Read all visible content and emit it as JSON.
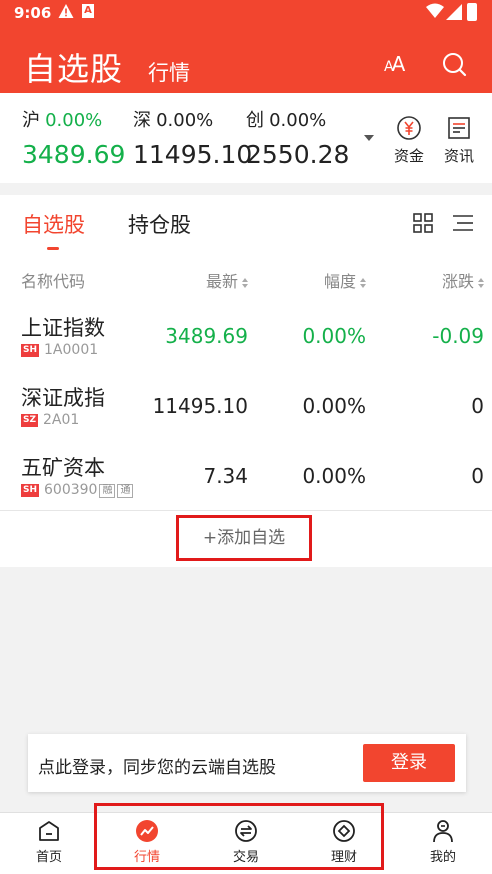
{
  "status_bar": {
    "time": "9:06",
    "a_badge": "A"
  },
  "header": {
    "title": "自选股",
    "subtitle": "行情",
    "font_size_label_big": "A",
    "font_size_label_small": "A"
  },
  "indices": [
    {
      "name": "沪",
      "pct": "0.00%",
      "value": "3489.69",
      "color": "#14b04a"
    },
    {
      "name": "深",
      "pct": "0.00%",
      "value": "11495.10",
      "color": "#222222"
    },
    {
      "name": "创",
      "pct": "0.00%",
      "value": "2550.28",
      "color": "#222222"
    }
  ],
  "side_buttons": {
    "funds": "资金",
    "news": "资讯"
  },
  "tabs": [
    {
      "label": "自选股",
      "active": true
    },
    {
      "label": "持仓股",
      "active": false
    }
  ],
  "columns": {
    "name_code": "名称代码",
    "latest": "最新",
    "change_pct": "幅度",
    "change": "涨跌"
  },
  "stocks": [
    {
      "name": "上证指数",
      "market": "SH",
      "code": "1A0001",
      "tags": [],
      "latest": "3489.69",
      "change_pct": "0.00%",
      "change": "-0.09",
      "color": "#14b04a"
    },
    {
      "name": "深证成指",
      "market": "SZ",
      "code": "2A01",
      "tags": [],
      "latest": "11495.10",
      "change_pct": "0.00%",
      "change": "0",
      "color": "#222222"
    },
    {
      "name": "五矿资本",
      "market": "SH",
      "code": "600390",
      "tags": [
        "融",
        "通"
      ],
      "latest": "7.34",
      "change_pct": "0.00%",
      "change": "0",
      "color": "#222222"
    }
  ],
  "add_watchlist": "+添加自选",
  "login_bar": {
    "text": "点此登录，同步您的云端自选股",
    "button": "登录"
  },
  "nav": [
    {
      "label": "首页",
      "icon": "home-icon"
    },
    {
      "label": "行情",
      "icon": "market-trend-icon",
      "active": true
    },
    {
      "label": "交易",
      "icon": "trade-exchange-icon"
    },
    {
      "label": "理财",
      "icon": "wealth-diamond-icon"
    },
    {
      "label": "我的",
      "icon": "profile-icon"
    }
  ],
  "colors": {
    "brand_red": "#f2452f",
    "up_green": "#14b04a",
    "highlight_red": "#e11a1a"
  }
}
